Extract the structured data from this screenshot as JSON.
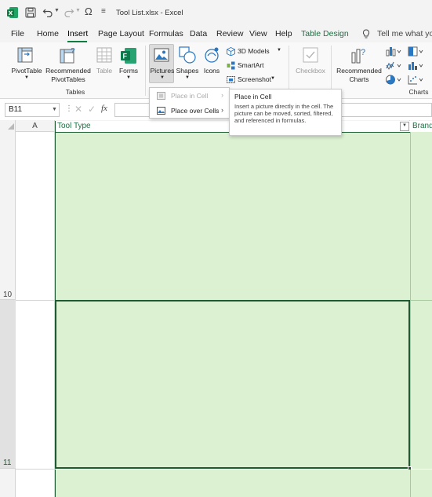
{
  "titlebar": {
    "file_title": "Tool List.xlsx  -  Excel",
    "customize_glyph": "≡"
  },
  "tabs": [
    {
      "label": "File"
    },
    {
      "label": "Home"
    },
    {
      "label": "Insert"
    },
    {
      "label": "Page Layout"
    },
    {
      "label": "Formulas"
    },
    {
      "label": "Data"
    },
    {
      "label": "Review"
    },
    {
      "label": "View"
    },
    {
      "label": "Help"
    },
    {
      "label": "Table Design"
    }
  ],
  "tell_me": "Tell me what you",
  "ribbon": {
    "pivottable": "PivotTable",
    "recommended_pivot_1": "Recommended",
    "recommended_pivot_2": "PivotTables",
    "table": "Table",
    "forms": "Forms",
    "tables_group": "Tables",
    "pictures": "Pictures",
    "shapes": "Shapes",
    "icons": "Icons",
    "models_3d": "3D Models",
    "smartart": "SmartArt",
    "screenshot": "Screenshot",
    "checkbox": "Checkbox",
    "recommended_charts_1": "Recommended",
    "recommended_charts_2": "Charts",
    "charts_group": "Charts"
  },
  "formula_bar": {
    "name_box": "B11",
    "fx": "fx"
  },
  "grid": {
    "col_a": "A",
    "col_b": "Tool Type",
    "col_c": "Brand",
    "row_10": "10",
    "row_11": "11"
  },
  "pictures_menu": {
    "place_in_cell": "Place in Cell",
    "place_over_cells": "Place over Cells"
  },
  "tooltip": {
    "title": "Place in Cell",
    "body": "Insert a picture directly in the cell. The picture can be moved, sorted, filtered, and referenced in formulas."
  },
  "colors": {
    "excel_green": "#107c41",
    "table_fill": "#dcf0d2",
    "table_border": "#1e5a32",
    "accent_green": "#1d6f42"
  }
}
